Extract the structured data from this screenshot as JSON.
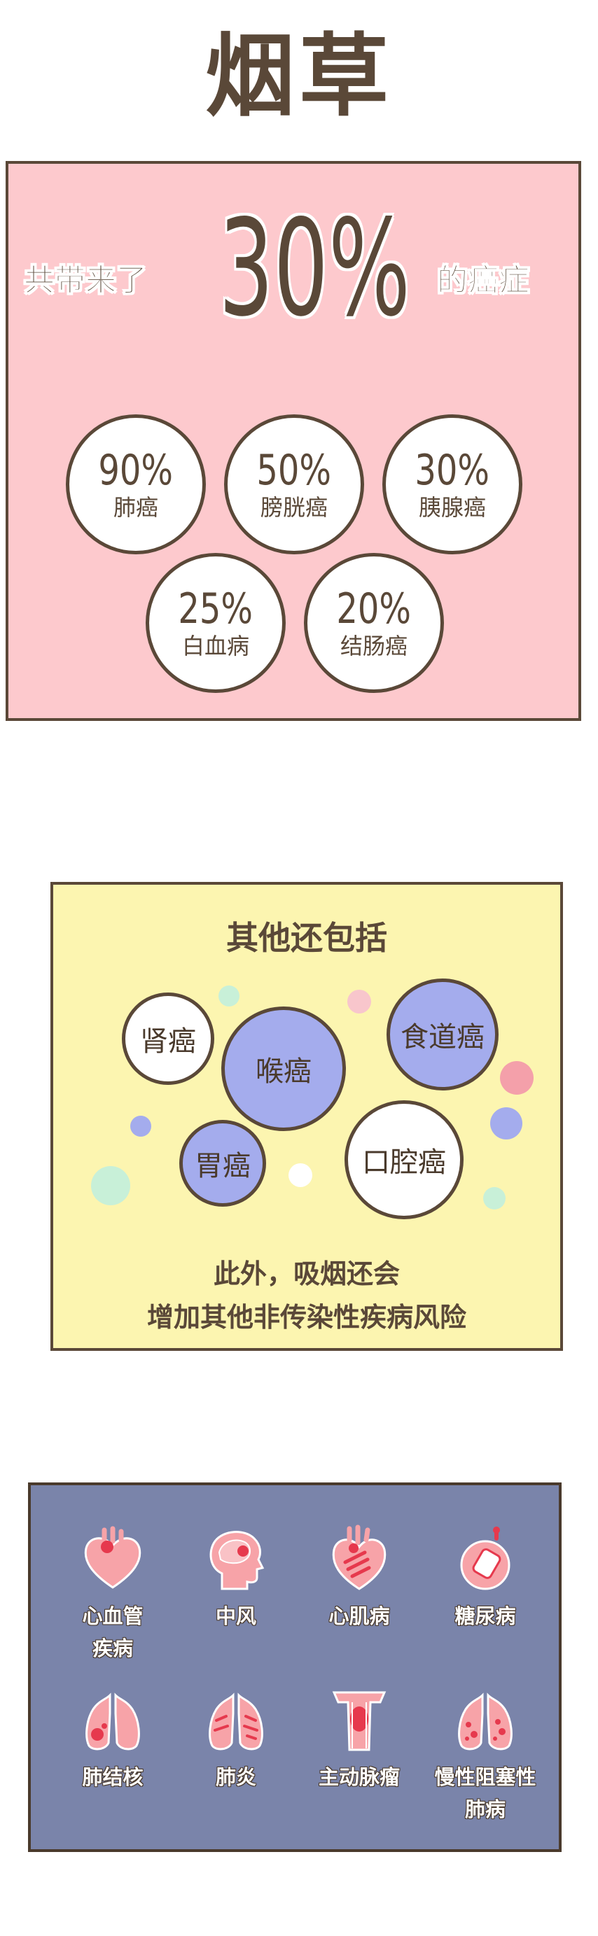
{
  "title": "烟草",
  "cancer_panel": {
    "lead_text": "共带来了",
    "big_value": "30%",
    "tail_text": "的癌症",
    "stats": [
      {
        "value": "90%",
        "label": "肺癌"
      },
      {
        "value": "50%",
        "label": "膀胱癌"
      },
      {
        "value": "30%",
        "label": "胰腺癌"
      },
      {
        "value": "25%",
        "label": "白血病"
      },
      {
        "value": "20%",
        "label": "结肠癌"
      }
    ]
  },
  "other_panel": {
    "title": "其他还包括",
    "cancers": [
      "肾癌",
      "喉癌",
      "食道癌",
      "胃癌",
      "口腔癌"
    ],
    "footer_line1": "此外，吸烟还会",
    "footer_line2": "增加其他非传染性疾病风险"
  },
  "disease_panel": {
    "items": [
      {
        "label_line1": "心血管",
        "label_line2": "疾病",
        "icon": "heart-icon"
      },
      {
        "label_line1": "中风",
        "label_line2": "",
        "icon": "head-brain-icon"
      },
      {
        "label_line1": "心肌病",
        "label_line2": "",
        "icon": "heart-muscle-icon"
      },
      {
        "label_line1": "糖尿病",
        "label_line2": "",
        "icon": "glucose-meter-icon"
      },
      {
        "label_line1": "肺结核",
        "label_line2": "",
        "icon": "lungs-icon"
      },
      {
        "label_line1": "肺炎",
        "label_line2": "",
        "icon": "lungs-inflamed-icon"
      },
      {
        "label_line1": "主动脉瘤",
        "label_line2": "",
        "icon": "aorta-icon"
      },
      {
        "label_line1": "慢性阻塞性",
        "label_line2": "肺病",
        "icon": "lungs-copd-icon"
      }
    ]
  },
  "colors": {
    "pink_bg": "#fdc9cd",
    "yellow_bg": "#fcf5b0",
    "blue_bg": "#7a84aa",
    "bubble_blue": "#a4aced",
    "outline": "#5a4838",
    "icon_pink": "#f7a3a8",
    "icon_red": "#e6394d"
  }
}
